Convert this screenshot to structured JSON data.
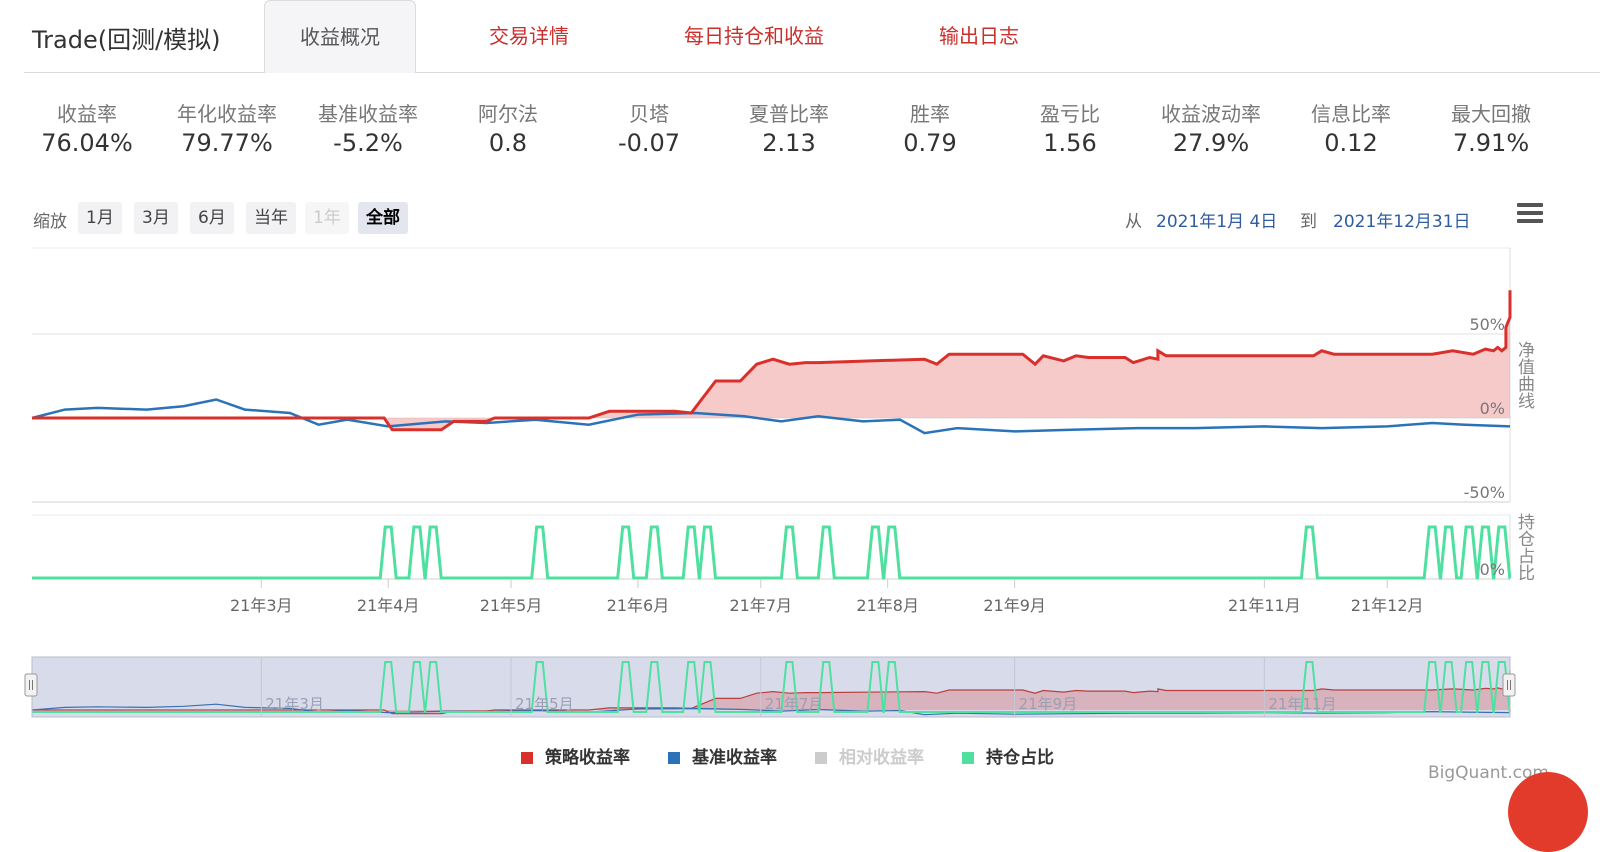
{
  "header": {
    "title": "Trade(回测/模拟)",
    "tabs": [
      {
        "label": "收益概况",
        "active": true
      },
      {
        "label": "交易详情",
        "active": false
      },
      {
        "label": "每日持仓和收益",
        "active": false
      },
      {
        "label": "输出日志",
        "active": false
      }
    ]
  },
  "metrics": [
    {
      "label": "收益率",
      "value": "76.04%"
    },
    {
      "label": "年化收益率",
      "value": "79.77%"
    },
    {
      "label": "基准收益率",
      "value": "-5.2%"
    },
    {
      "label": "阿尔法",
      "value": "0.8"
    },
    {
      "label": "贝塔",
      "value": "-0.07"
    },
    {
      "label": "夏普比率",
      "value": "2.13"
    },
    {
      "label": "胜率",
      "value": "0.79"
    },
    {
      "label": "盈亏比",
      "value": "1.56"
    },
    {
      "label": "收益波动率",
      "value": "27.9%"
    },
    {
      "label": "信息比率",
      "value": "0.12"
    },
    {
      "label": "最大回撤",
      "value": "7.91%"
    }
  ],
  "zoom": {
    "label": "缩放",
    "buttons": [
      {
        "label": "1月",
        "state": "normal"
      },
      {
        "label": "3月",
        "state": "normal"
      },
      {
        "label": "6月",
        "state": "normal"
      },
      {
        "label": "当年",
        "state": "normal"
      },
      {
        "label": "1年",
        "state": "disabled"
      },
      {
        "label": "全部",
        "state": "selected"
      }
    ]
  },
  "range": {
    "from_label": "从",
    "from": "2021年1月 4日",
    "to_label": "到",
    "to": "2021年12月31日"
  },
  "legend": [
    {
      "label": "策略收益率",
      "color": "#d9302b",
      "enabled": true
    },
    {
      "label": "基准收益率",
      "color": "#2b73b8",
      "enabled": true
    },
    {
      "label": "相对收益率",
      "color": "#cccccc",
      "enabled": false
    },
    {
      "label": "持仓占比",
      "color": "#4fe0a0",
      "enabled": true
    }
  ],
  "watermark": "BigQuant.com",
  "chart_data": [
    {
      "type": "area",
      "ylabel": "净值曲线",
      "ylim": [
        -50,
        75
      ],
      "yticks": [
        "50%",
        "0%",
        "-50%"
      ],
      "x_range": [
        "2021-01-04",
        "2021-12-31"
      ],
      "series": [
        {
          "name": "策略收益率",
          "color": "#d9302b",
          "points": [
            [
              "2021-01-04",
              0
            ],
            [
              "2021-03-31",
              0
            ],
            [
              "2021-04-02",
              -7
            ],
            [
              "2021-04-14",
              -7
            ],
            [
              "2021-04-17",
              -2
            ],
            [
              "2021-04-25",
              -2
            ],
            [
              "2021-04-27",
              0
            ],
            [
              "2021-05-20",
              0
            ],
            [
              "2021-05-25",
              4
            ],
            [
              "2021-06-10",
              4
            ],
            [
              "2021-06-14",
              3
            ],
            [
              "2021-06-20",
              22
            ],
            [
              "2021-06-26",
              22
            ],
            [
              "2021-06-30",
              32
            ],
            [
              "2021-07-04",
              35
            ],
            [
              "2021-07-08",
              32
            ],
            [
              "2021-07-12",
              33
            ],
            [
              "2021-07-15",
              33
            ],
            [
              "2021-08-10",
              35
            ],
            [
              "2021-08-13",
              32
            ],
            [
              "2021-08-16",
              38
            ],
            [
              "2021-09-03",
              38
            ],
            [
              "2021-09-06",
              32
            ],
            [
              "2021-09-08",
              37
            ],
            [
              "2021-09-13",
              34
            ],
            [
              "2021-09-16",
              37
            ],
            [
              "2021-09-19",
              36
            ],
            [
              "2021-09-28",
              36
            ],
            [
              "2021-09-30",
              33
            ],
            [
              "2021-10-04",
              36
            ],
            [
              "2021-10-06",
              35
            ],
            [
              "2021-10-06",
              36
            ],
            [
              "2021-10-06",
              40
            ],
            [
              "2021-10-08",
              37
            ],
            [
              "2021-11-13",
              37
            ],
            [
              "2021-11-15",
              40
            ],
            [
              "2021-11-18",
              38
            ],
            [
              "2021-12-12",
              38
            ],
            [
              "2021-12-17",
              40
            ],
            [
              "2021-12-22",
              38
            ],
            [
              "2021-12-25",
              41
            ],
            [
              "2021-12-27",
              40
            ],
            [
              "2021-12-28",
              42
            ],
            [
              "2021-12-29",
              40
            ],
            [
              "2021-12-30",
              42
            ],
            [
              "2021-12-30",
              54
            ],
            [
              "2021-12-31",
              60
            ],
            [
              "2021-12-31",
              65
            ],
            [
              "2021-12-31",
              76
            ]
          ]
        },
        {
          "name": "基准收益率",
          "color": "#2b73b8",
          "points": [
            [
              "2021-01-04",
              0
            ],
            [
              "2021-01-12",
              5
            ],
            [
              "2021-01-20",
              6
            ],
            [
              "2021-02-01",
              5
            ],
            [
              "2021-02-10",
              7
            ],
            [
              "2021-02-18",
              11
            ],
            [
              "2021-02-25",
              5
            ],
            [
              "2021-03-08",
              3
            ],
            [
              "2021-03-15",
              -4
            ],
            [
              "2021-03-22",
              -1
            ],
            [
              "2021-04-01",
              -5
            ],
            [
              "2021-04-15",
              -2
            ],
            [
              "2021-04-25",
              -3
            ],
            [
              "2021-05-07",
              -1
            ],
            [
              "2021-05-20",
              -4
            ],
            [
              "2021-06-01",
              2
            ],
            [
              "2021-06-15",
              3
            ],
            [
              "2021-06-27",
              1
            ],
            [
              "2021-07-06",
              -2
            ],
            [
              "2021-07-15",
              1
            ],
            [
              "2021-07-26",
              -2
            ],
            [
              "2021-08-04",
              -1
            ],
            [
              "2021-08-10",
              -9
            ],
            [
              "2021-08-18",
              -6
            ],
            [
              "2021-09-01",
              -8
            ],
            [
              "2021-09-15",
              -7
            ],
            [
              "2021-10-01",
              -6
            ],
            [
              "2021-10-15",
              -6
            ],
            [
              "2021-11-01",
              -5
            ],
            [
              "2021-11-15",
              -6
            ],
            [
              "2021-12-01",
              -5
            ],
            [
              "2021-12-12",
              -3
            ],
            [
              "2021-12-20",
              -4
            ],
            [
              "2021-12-31",
              -5
            ]
          ]
        }
      ]
    },
    {
      "type": "line",
      "ylabel": "持仓占比",
      "yticks": [
        "0%"
      ],
      "series": [
        {
          "name": "持仓占比",
          "color": "#4fe0a0",
          "active_dates": [
            "2021-04-01",
            "2021-04-08",
            "2021-04-12",
            "2021-05-08",
            "2021-05-29",
            "2021-06-05",
            "2021-06-14",
            "2021-06-18",
            "2021-07-08",
            "2021-07-17",
            "2021-07-29",
            "2021-08-02",
            "2021-11-12",
            "2021-12-12",
            "2021-12-16",
            "2021-12-21",
            "2021-12-25",
            "2021-12-29"
          ]
        }
      ]
    }
  ],
  "x_axis": {
    "ticks": [
      {
        "label": "21年3月",
        "date": "2021-03-01"
      },
      {
        "label": "21年4月",
        "date": "2021-04-01"
      },
      {
        "label": "21年5月",
        "date": "2021-05-01"
      },
      {
        "label": "21年6月",
        "date": "2021-06-01"
      },
      {
        "label": "21年7月",
        "date": "2021-07-01"
      },
      {
        "label": "21年8月",
        "date": "2021-08-01"
      },
      {
        "label": "21年9月",
        "date": "2021-09-01"
      },
      {
        "label": "21年11月",
        "date": "2021-11-01"
      },
      {
        "label": "21年12月",
        "date": "2021-12-01"
      }
    ],
    "navigator_ticks": [
      {
        "label": "21年3月",
        "date": "2021-03-01"
      },
      {
        "label": "21年5月",
        "date": "2021-05-01"
      },
      {
        "label": "21年7月",
        "date": "2021-07-01"
      },
      {
        "label": "21年9月",
        "date": "2021-09-01"
      },
      {
        "label": "21年11月",
        "date": "2021-11-01"
      }
    ]
  }
}
